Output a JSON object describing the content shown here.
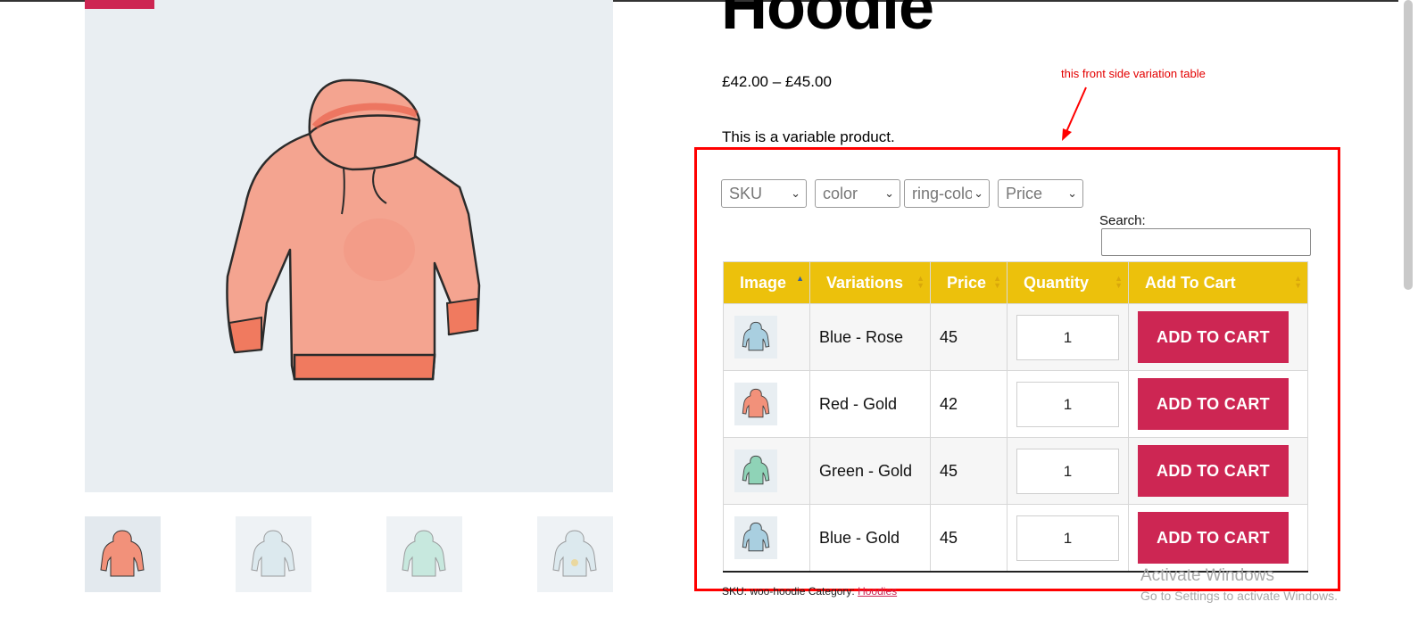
{
  "product": {
    "title": "Hoodie",
    "price_range": "£42.00 – £45.00",
    "description": "This is a variable product."
  },
  "annotation": {
    "text": "this front side variation table",
    "color": "#ff0000"
  },
  "filters": [
    {
      "label": "SKU"
    },
    {
      "label": "color"
    },
    {
      "label": "ring-color"
    },
    {
      "label": "Price"
    }
  ],
  "search": {
    "label": "Search:",
    "value": ""
  },
  "table": {
    "headers": [
      "Image",
      "Variations",
      "Price",
      "Quantity",
      "Add To Cart"
    ],
    "rows": [
      {
        "thumb_color": "#a9cfe0",
        "variation": "Blue - Rose",
        "price": "45",
        "quantity": "1",
        "button": "ADD TO CART"
      },
      {
        "thumb_color": "#f2917a",
        "variation": "Red - Gold",
        "price": "42",
        "quantity": "1",
        "button": "ADD TO CART"
      },
      {
        "thumb_color": "#8fd3b7",
        "variation": "Green - Gold",
        "price": "45",
        "quantity": "1",
        "button": "ADD TO CART"
      },
      {
        "thumb_color": "#a9cfe0",
        "variation": "Blue - Gold",
        "price": "45",
        "quantity": "1",
        "button": "ADD TO CART"
      }
    ]
  },
  "meta": {
    "sku_text": "SKU: woo-hoodie Category:",
    "category": "Hoodies"
  },
  "gallery": {
    "main_color": "#f4a490",
    "thumbs": [
      "#f2917a",
      "#cfe3ea",
      "#a9e0cc",
      "#cfe3ea"
    ]
  },
  "watermark": {
    "line1": "Activate Windows",
    "line2": "Go to Settings to activate Windows."
  },
  "colors": {
    "accent": "#cd2653",
    "table_header": "#ecc10c"
  }
}
